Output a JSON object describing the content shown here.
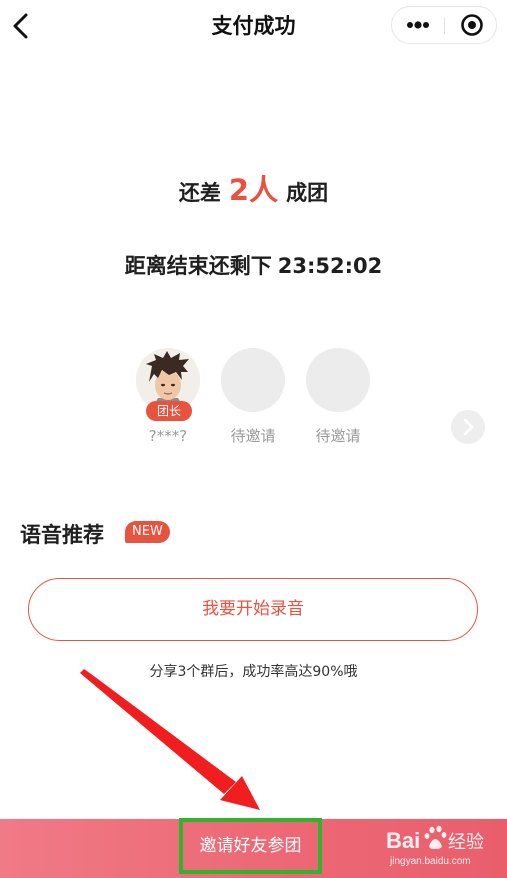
{
  "nav": {
    "title": "支付成功",
    "back_icon": "chevron-left-icon",
    "more_icon": "more-dots-icon",
    "close_icon": "target-circle-icon"
  },
  "group_status": {
    "prefix": "还差",
    "count": "2人",
    "suffix": "成团",
    "countdown_label": "距离结束还剩下",
    "countdown_time": "23:52:02"
  },
  "members": [
    {
      "name": "?***?",
      "badge": "团长",
      "filled": true
    },
    {
      "name": "待邀请",
      "filled": false
    },
    {
      "name": "待邀请",
      "filled": false
    }
  ],
  "voice": {
    "title": "语音推荐",
    "new_badge": "NEW",
    "record_button": "我要开始录音",
    "share_tip": "分享3个群后，成功率高达90%哦"
  },
  "bottom": {
    "invite_button": "邀请好友参团"
  },
  "watermark": {
    "brand": "Bai",
    "brand_suffix": "经验",
    "url": "jingyan.baidu.com"
  },
  "colors": {
    "accent": "#e8533f",
    "bottom_bar": "#ec6a76",
    "highlight_box": "#2fb52d",
    "annotation_arrow": "#f01e1e"
  }
}
